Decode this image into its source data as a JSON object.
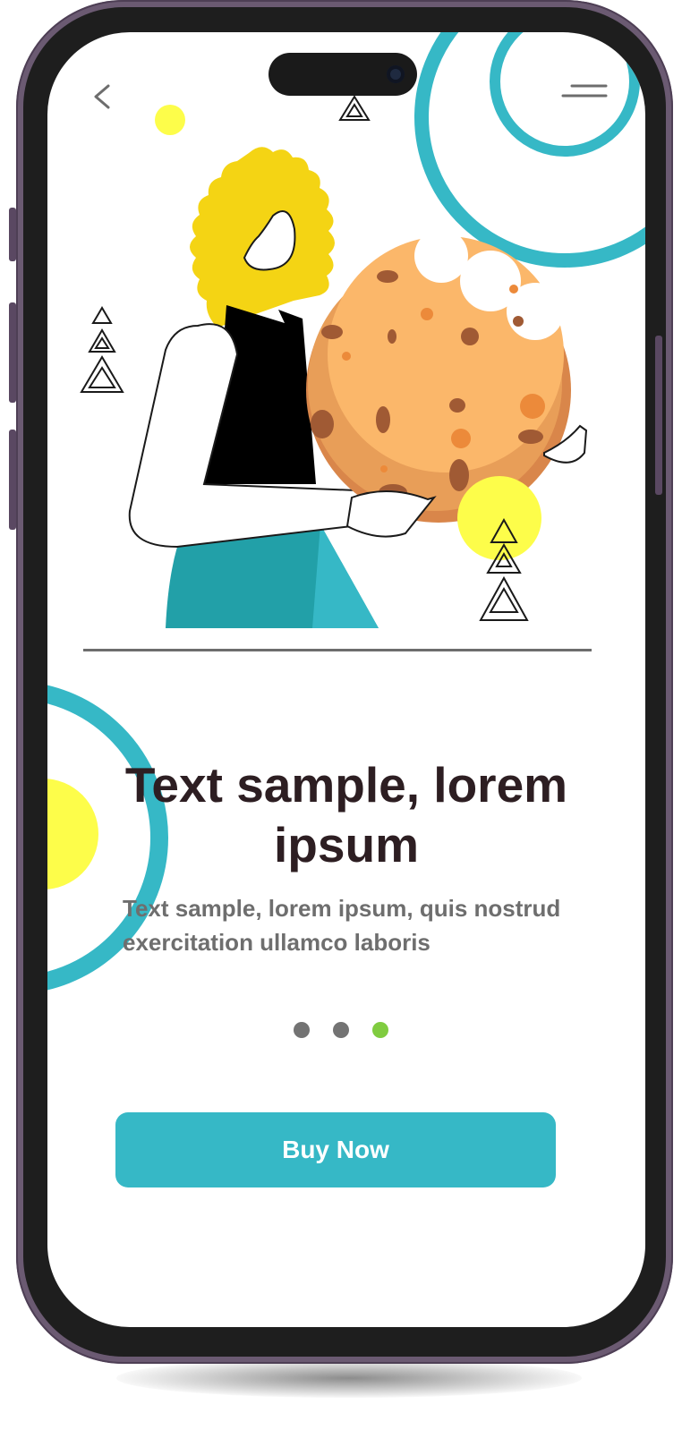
{
  "content": {
    "headline": "Text sample, lorem ipsum",
    "subtext": "Text sample, lorem ipsum, quis nostrud exercitation ullamco laboris",
    "cta_label": "Buy Now"
  },
  "navigation": {
    "back_icon": "chevron-left-icon",
    "menu_icon": "menu-icon"
  },
  "pager": {
    "total": 3,
    "active_index": 2
  },
  "colors": {
    "accent_teal": "#36b8c6",
    "active_dot": "#80cc40",
    "inactive_dot": "#737373",
    "headline": "#2d1e22",
    "body_text": "#6e6e6e",
    "hair_yellow": "#f4d414",
    "cookie": "#fbb76a",
    "phone_frame": "#6b5a72"
  },
  "illustration": {
    "subject": "woman holding a large bitten chocolate chip cookie"
  }
}
